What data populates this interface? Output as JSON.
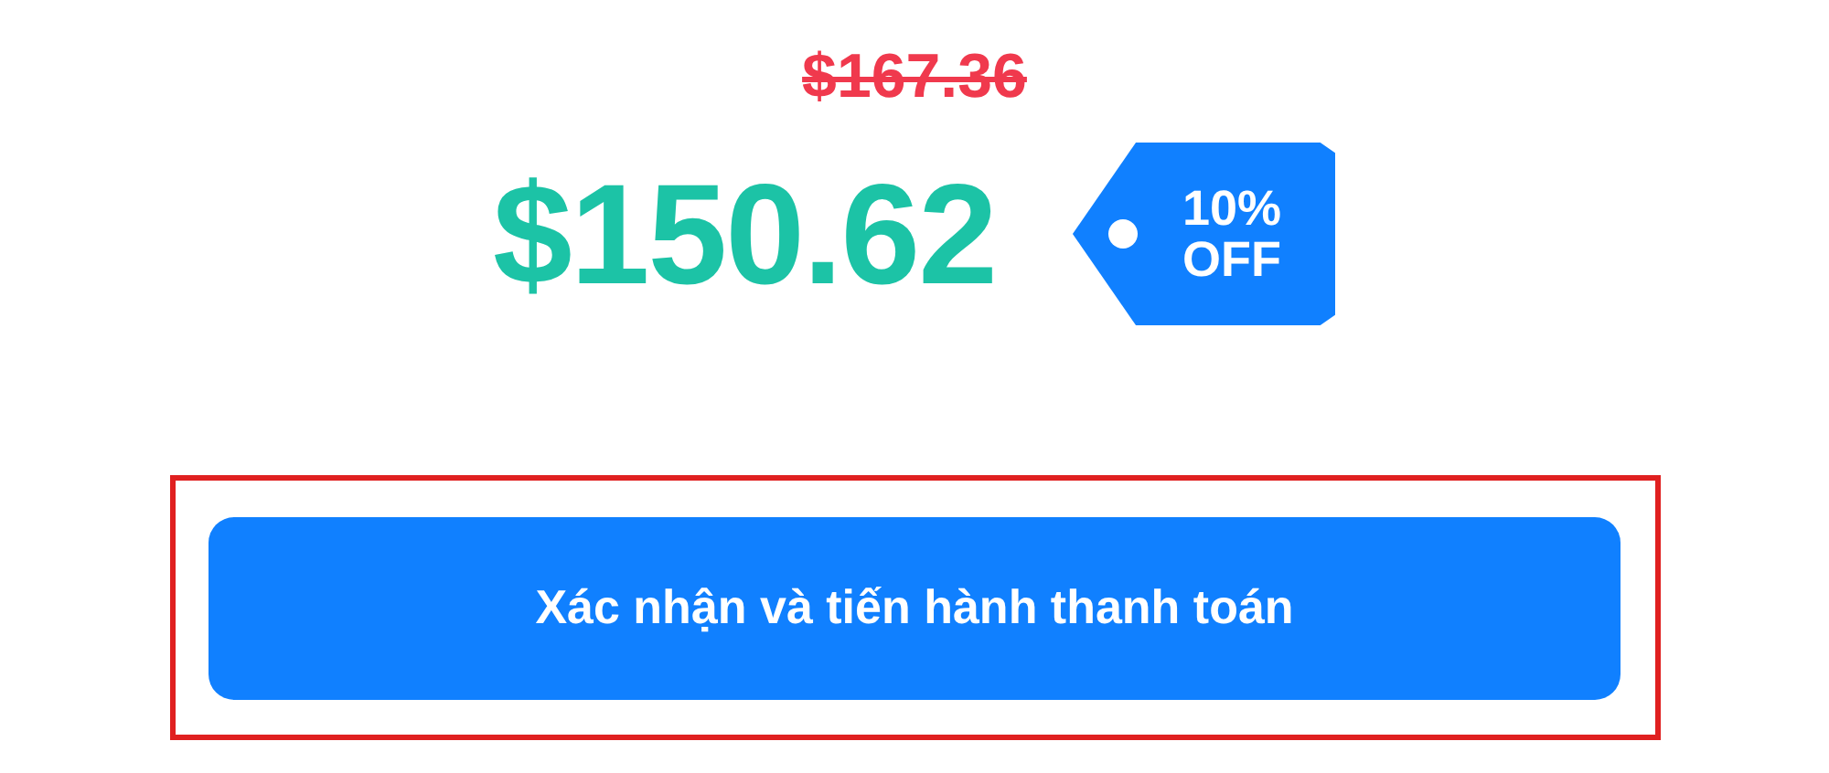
{
  "original_price": "$167.36",
  "price": "$150.62",
  "discount_tag": {
    "label": "10% OFF"
  },
  "confirm_button": {
    "label": "Xác nhận và tiến hành thanh toán",
    "highlighted": true
  }
}
